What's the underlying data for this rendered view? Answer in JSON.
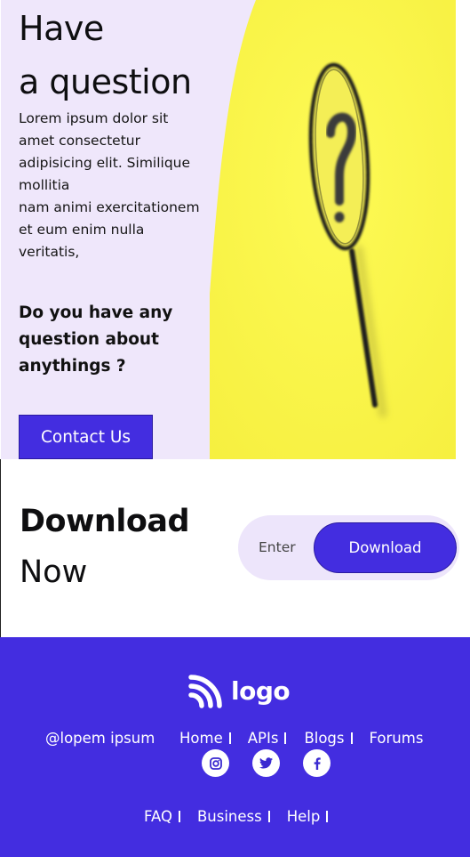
{
  "hero": {
    "title_line1": "Have",
    "title_line2": "a question",
    "body_line1": "Lorem ipsum dolor sit",
    "body_line2": "amet consectetur",
    "body_line3": "adipisicing elit. Similique",
    "body_line4": "mollitia",
    "body_line5": "nam animi exercitationem",
    "body_line6": "et eum enim nulla",
    "body_line7": "veritatis,",
    "sub_line1": "Do you have any",
    "sub_line2": "question about",
    "sub_line3": "anythings ?",
    "contact_label": "Contact Us",
    "image_icon": "magnifying-glass-question-icon",
    "image_bg": "#fbf64b"
  },
  "download": {
    "title_bold": "Download",
    "title_light": "Now",
    "input_placeholder": "Enter",
    "button_label": "Download"
  },
  "footer": {
    "logo_text": "logo",
    "logo_icon": "rss-icon",
    "handle": "@lopem ipsum",
    "nav_primary": [
      "Home",
      "APIs",
      "Blogs",
      "Forums"
    ],
    "social": [
      "instagram-icon",
      "twitter-icon",
      "facebook-icon"
    ],
    "nav_secondary": [
      "FAQ",
      "Business",
      "Help"
    ]
  },
  "colors": {
    "accent": "#432de0",
    "hero_bg": "#efe7fb",
    "pill_bg": "#ede5fb",
    "image_bg": "#fbf64b"
  }
}
